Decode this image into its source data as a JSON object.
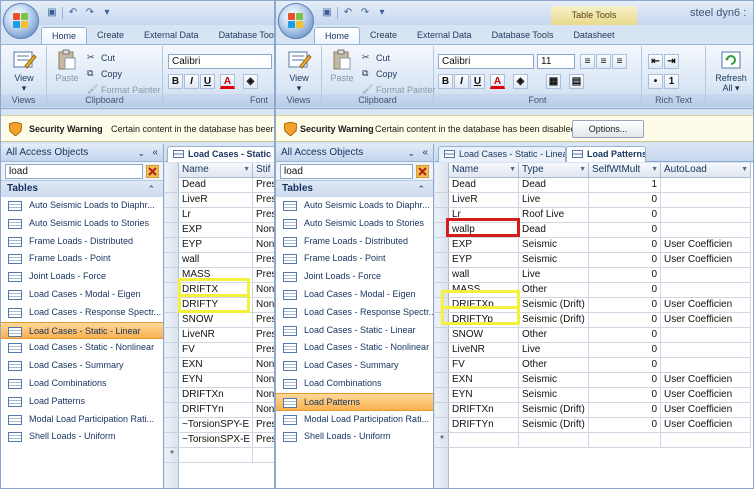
{
  "left_window": {
    "qat": [
      "save-icon",
      "undo-icon",
      "redo-icon",
      "customize-icon"
    ],
    "tabs": [
      "Home",
      "Create",
      "External Data",
      "Database Tools"
    ],
    "active_tab": "Home",
    "ribbon": {
      "view_label": "View",
      "views_group": "Views",
      "paste_label": "Paste",
      "cut_label": "Cut",
      "copy_label": "Copy",
      "format_painter_label": "Format Painter",
      "clipboard_group": "Clipboard",
      "font_name": "Calibri",
      "bold": "B",
      "italic": "I",
      "underline": "U",
      "font_color": "A",
      "font_group": "Font"
    },
    "security": {
      "title": "Security Warning",
      "message": "Certain content in the database has been di"
    },
    "nav": {
      "header": "All Access Objects",
      "search_value": "load",
      "section": "Tables",
      "items": [
        "Auto Seismic Loads to Diaphr...",
        "Auto Seismic Loads to Stories",
        "Frame Loads - Distributed",
        "Frame Loads - Point",
        "Joint Loads - Force",
        "Load Cases - Modal - Eigen",
        "Load Cases - Response Spectr...",
        "Load Cases - Static - Linear",
        "Load Cases - Static - Nonlinear",
        "Load Cases - Summary",
        "Load Combinations",
        "Load Patterns",
        "Modal Load Participation Rati...",
        "Shell Loads - Uniform"
      ],
      "selected_index": 7
    },
    "doc_tab": "Load Cases - Static - Li",
    "grid": {
      "columns": [
        "Name",
        "Stif"
      ],
      "rows": [
        [
          "Dead",
          "Pres"
        ],
        [
          "LiveR",
          "Pres"
        ],
        [
          "Lr",
          "Pres"
        ],
        [
          "EXP",
          "Nonl"
        ],
        [
          "EYP",
          "Nonl"
        ],
        [
          "wall",
          "Pres"
        ],
        [
          "MASS",
          "Pres"
        ],
        [
          "DRIFTX",
          "Nonl"
        ],
        [
          "DRIFTY",
          "Nonl"
        ],
        [
          "SNOW",
          "Pres"
        ],
        [
          "LiveNR",
          "Pres"
        ],
        [
          "FV",
          "Pres"
        ],
        [
          "EXN",
          "Nonl"
        ],
        [
          "EYN",
          "Nonl"
        ],
        [
          "DRIFTXn",
          "Nonl"
        ],
        [
          "DRIFTYn",
          "Nonl"
        ],
        [
          "~TorsionSPY-E",
          "Pres"
        ],
        [
          "~TorsionSPX-E",
          "Pres"
        ]
      ],
      "new_row_marker": "*"
    }
  },
  "right_window": {
    "title": "steel dyn6 :",
    "context_tab_group": "Table Tools",
    "tabs": [
      "Home",
      "Create",
      "External Data",
      "Database Tools",
      "Datasheet"
    ],
    "active_tab": "Home",
    "ribbon": {
      "view_label": "View",
      "views_group": "Views",
      "paste_label": "Paste",
      "cut_label": "Cut",
      "copy_label": "Copy",
      "format_painter_label": "Format Painter",
      "clipboard_group": "Clipboard",
      "font_name": "Calibri",
      "font_size": "11",
      "bold": "B",
      "italic": "I",
      "underline": "U",
      "font_color": "A",
      "font_group": "Font",
      "rich_text_group": "Rich Text",
      "refresh_label": "Refresh",
      "refresh_label2": "All"
    },
    "security": {
      "title": "Security Warning",
      "message": "Certain content in the database has been disabled",
      "options_button": "Options..."
    },
    "nav": {
      "header": "All Access Objects",
      "search_value": "load",
      "section": "Tables",
      "items": [
        "Auto Seismic Loads to Diaphr...",
        "Auto Seismic Loads to Stories",
        "Frame Loads - Distributed",
        "Frame Loads - Point",
        "Joint Loads - Force",
        "Load Cases - Modal - Eigen",
        "Load Cases - Response Spectr...",
        "Load Cases - Static - Linear",
        "Load Cases - Static - Nonlinear",
        "Load Cases - Summary",
        "Load Combinations",
        "Load Patterns",
        "Modal Load Participation Rati...",
        "Shell Loads - Uniform"
      ],
      "selected_index": 11
    },
    "doc_tabs": [
      "Load Cases - Static - Linear",
      "Load Patterns"
    ],
    "active_doc_tab": 1,
    "grid": {
      "columns": [
        "Name",
        "Type",
        "SelfWtMult",
        "AutoLoad"
      ],
      "rows": [
        [
          "Dead",
          "Dead",
          "1",
          ""
        ],
        [
          "LiveR",
          "Live",
          "0",
          ""
        ],
        [
          "Lr",
          "Roof Live",
          "0",
          ""
        ],
        [
          "wallp",
          "Dead",
          "0",
          ""
        ],
        [
          "EXP",
          "Seismic",
          "0",
          "User Coefficien"
        ],
        [
          "EYP",
          "Seismic",
          "0",
          "User Coefficien"
        ],
        [
          "wall",
          "Live",
          "0",
          ""
        ],
        [
          "MASS",
          "Other",
          "0",
          ""
        ],
        [
          "DRIFTXp",
          "Seismic (Drift)",
          "0",
          "User Coefficien"
        ],
        [
          "DRIFTYp",
          "Seismic (Drift)",
          "0",
          "User Coefficien"
        ],
        [
          "SNOW",
          "Other",
          "0",
          ""
        ],
        [
          "LiveNR",
          "Live",
          "0",
          ""
        ],
        [
          "FV",
          "Other",
          "0",
          ""
        ],
        [
          "EXN",
          "Seismic",
          "0",
          "User Coefficien"
        ],
        [
          "EYN",
          "Seismic",
          "0",
          "User Coefficien"
        ],
        [
          "DRIFTXn",
          "Seismic (Drift)",
          "0",
          "User Coefficien"
        ],
        [
          "DRIFTYn",
          "Seismic (Drift)",
          "0",
          "User Coefficien"
        ]
      ],
      "new_row_marker": "*"
    }
  },
  "colors": {
    "highlight_yellow": "#f5f03a",
    "highlight_red": "#d41c1c",
    "selected_nav": "#f9b152"
  }
}
